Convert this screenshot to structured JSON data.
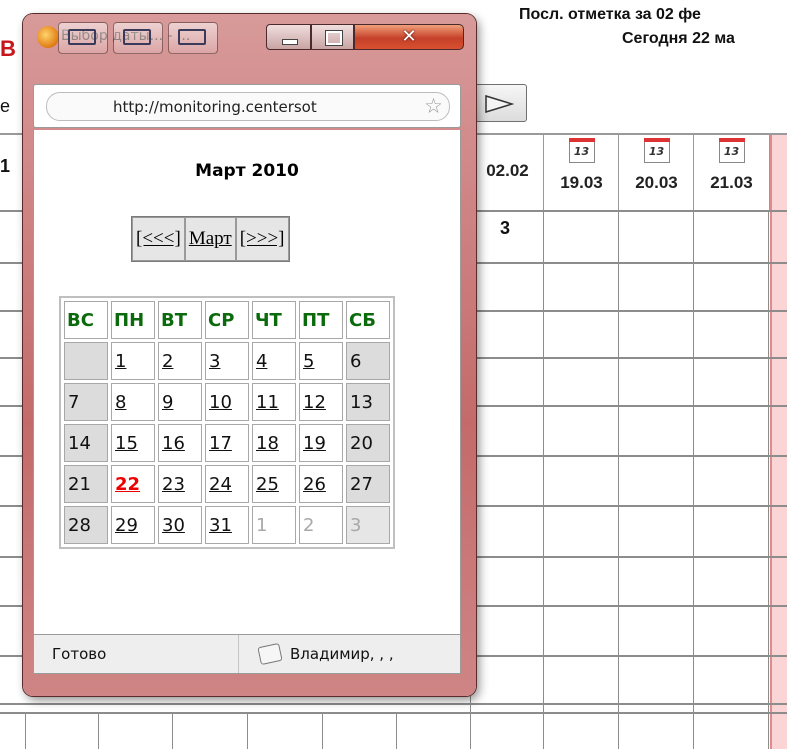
{
  "background": {
    "header_line1": "Посл. отметка за 02 фе",
    "header_line2": "Сегодня 22 ма",
    "left_letter_b": "В",
    "left_letter_e": "е",
    "left_digit": "1",
    "date_columns": [
      {
        "label": "02.02",
        "icon": false
      },
      {
        "label": "19.03",
        "icon": true,
        "icon_text": "13"
      },
      {
        "label": "20.03",
        "icon": true,
        "icon_text": "13"
      },
      {
        "label": "21.03",
        "icon": true,
        "icon_text": "13"
      }
    ],
    "cell_value": "3"
  },
  "popup": {
    "title": "Выбор даты... - ...",
    "url": "http://monitoring.centersot",
    "month_title": "Март 2010",
    "nav": {
      "prev": "[<<<]",
      "month": "Март",
      "next": "[>>>]"
    },
    "weekdays": [
      "ВС",
      "ПН",
      "ВТ",
      "СР",
      "ЧТ",
      "ПТ",
      "СБ"
    ],
    "weeks": [
      [
        "",
        "1",
        "2",
        "3",
        "4",
        "5",
        "6"
      ],
      [
        "7",
        "8",
        "9",
        "10",
        "11",
        "12",
        "13"
      ],
      [
        "14",
        "15",
        "16",
        "17",
        "18",
        "19",
        "20"
      ],
      [
        "21",
        "22",
        "23",
        "24",
        "25",
        "26",
        "27"
      ],
      [
        "28",
        "29",
        "30",
        "31",
        "1",
        "2",
        "3"
      ]
    ],
    "today": "22",
    "status": "Готово",
    "user": "Владимир, , ,"
  }
}
